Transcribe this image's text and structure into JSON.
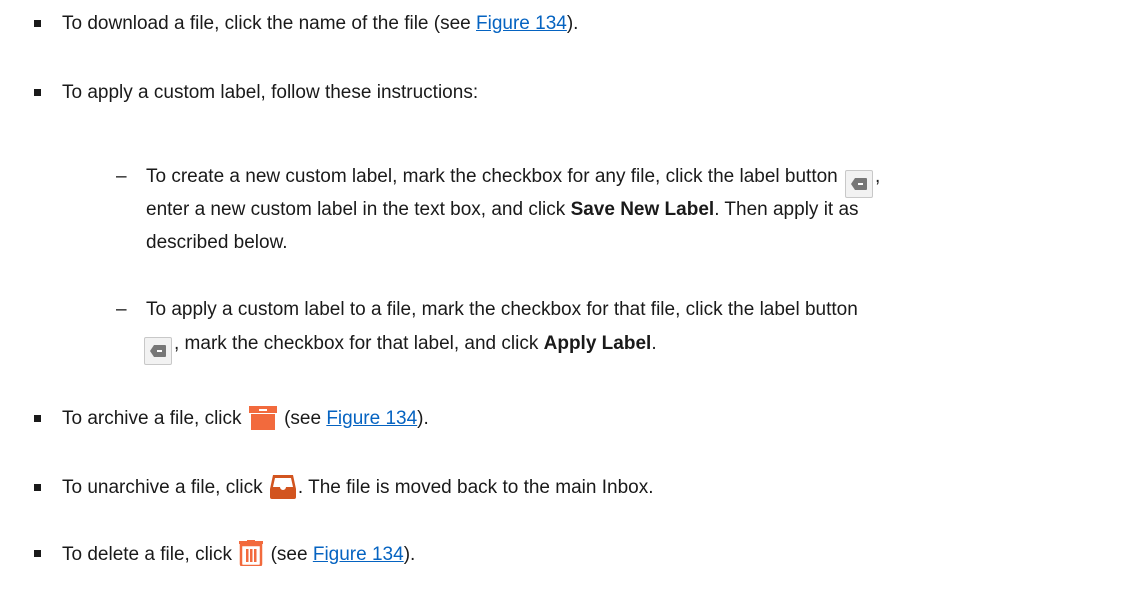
{
  "items": [
    {
      "pre": "To download a file, click the name of the file (see ",
      "link": "Figure 134",
      "post": ")."
    },
    {
      "text": "To apply a custom label, follow these instructions:"
    },
    {
      "sub": [
        {
          "line1_pre": "To create a new custom label, mark the checkbox for any file, click the label button ",
          "line1_post": ",",
          "line2_pre": "enter a new custom label in the text box, and click ",
          "line2_bold": "Save New Label",
          "line2_post": ". Then apply it as",
          "line3": "described below."
        },
        {
          "line1": "To apply a custom label to a file, mark the checkbox for that file, click the label button",
          "line2_post": ", mark the checkbox for that label, and click ",
          "line2_bold": "Apply Label",
          "line2_end": "."
        }
      ]
    },
    {
      "pre": "To archive a file, click ",
      "mid": " (see ",
      "link": "Figure 134",
      "post": ")."
    },
    {
      "pre": "To unarchive a file, click ",
      "post": ". The file is moved back to the main Inbox."
    },
    {
      "pre": "To delete a file, click ",
      "mid": " (see ",
      "link": "Figure 134",
      "post": ")."
    }
  ],
  "icons": {
    "label": "label-icon",
    "archive": "archive-icon",
    "unarchive": "unarchive-icon",
    "delete": "trash-icon"
  },
  "colors": {
    "link": "#0563c1",
    "accent": "#f26a3d"
  }
}
